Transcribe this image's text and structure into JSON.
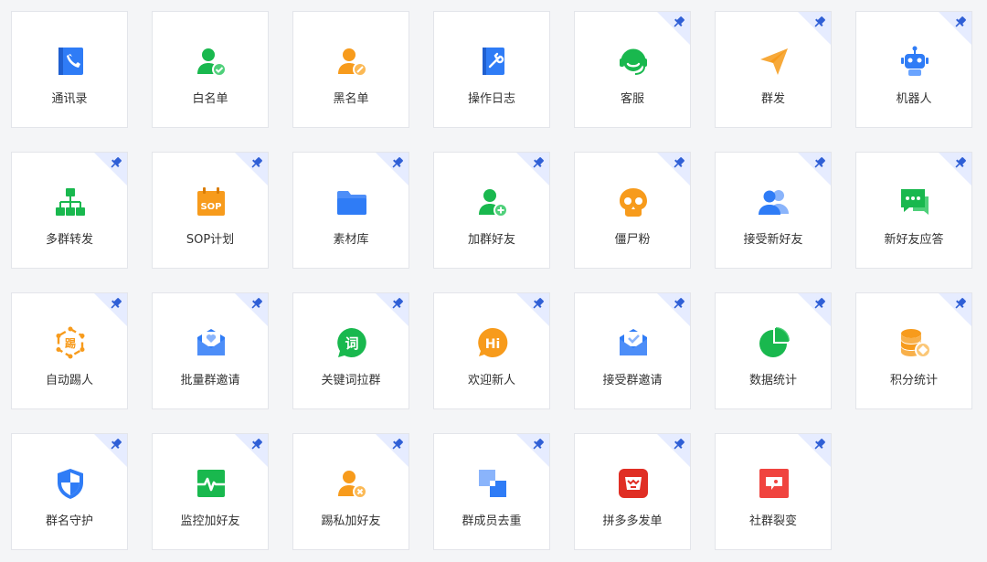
{
  "colors": {
    "blue": "#2f7cf6",
    "green": "#19b84e",
    "orange": "#f79b1c",
    "red": "#f0443f",
    "pin_bg": "#e6ecff",
    "pin": "#2f5fd6"
  },
  "tiles": [
    {
      "label": "通讯录",
      "icon": "contacts-icon",
      "pinned": false
    },
    {
      "label": "白名单",
      "icon": "user-check-icon",
      "pinned": false
    },
    {
      "label": "黑名单",
      "icon": "user-block-icon",
      "pinned": false
    },
    {
      "label": "操作日志",
      "icon": "log-book-icon",
      "pinned": false
    },
    {
      "label": "客服",
      "icon": "headset-icon",
      "pinned": true
    },
    {
      "label": "群发",
      "icon": "paper-plane-icon",
      "pinned": true
    },
    {
      "label": "机器人",
      "icon": "robot-icon",
      "pinned": true
    },
    {
      "label": "多群转发",
      "icon": "org-tree-icon",
      "pinned": true
    },
    {
      "label": "SOP计划",
      "icon": "sop-calendar-icon",
      "pinned": true
    },
    {
      "label": "素材库",
      "icon": "folder-icon",
      "pinned": true
    },
    {
      "label": "加群好友",
      "icon": "user-add-icon",
      "pinned": true
    },
    {
      "label": "僵尸粉",
      "icon": "skull-icon",
      "pinned": true
    },
    {
      "label": "接受新好友",
      "icon": "users-icon",
      "pinned": true
    },
    {
      "label": "新好友应答",
      "icon": "chat-reply-icon",
      "pinned": true
    },
    {
      "label": "自动踢人",
      "icon": "kick-icon",
      "pinned": true
    },
    {
      "label": "批量群邀请",
      "icon": "mail-heart-icon",
      "pinned": true
    },
    {
      "label": "关键词拉群",
      "icon": "keyword-chat-icon",
      "pinned": true
    },
    {
      "label": "欢迎新人",
      "icon": "hi-bubble-icon",
      "pinned": true
    },
    {
      "label": "接受群邀请",
      "icon": "mail-check-icon",
      "pinned": true
    },
    {
      "label": "数据统计",
      "icon": "pie-chart-icon",
      "pinned": true
    },
    {
      "label": "积分统计",
      "icon": "coins-icon",
      "pinned": true
    },
    {
      "label": "群名守护",
      "icon": "shield-icon",
      "pinned": true
    },
    {
      "label": "监控加好友",
      "icon": "pulse-monitor-icon",
      "pinned": true
    },
    {
      "label": "踢私加好友",
      "icon": "user-remove-icon",
      "pinned": true
    },
    {
      "label": "群成员去重",
      "icon": "dedupe-squares-icon",
      "pinned": true
    },
    {
      "label": "拼多多发单",
      "icon": "pinduoduo-icon",
      "pinned": true
    },
    {
      "label": "社群裂变",
      "icon": "fission-icon",
      "pinned": true
    }
  ],
  "icon_glyphs": {
    "keyword": "词",
    "hi": "Hi",
    "sop": "SOP",
    "kick": "踢"
  }
}
